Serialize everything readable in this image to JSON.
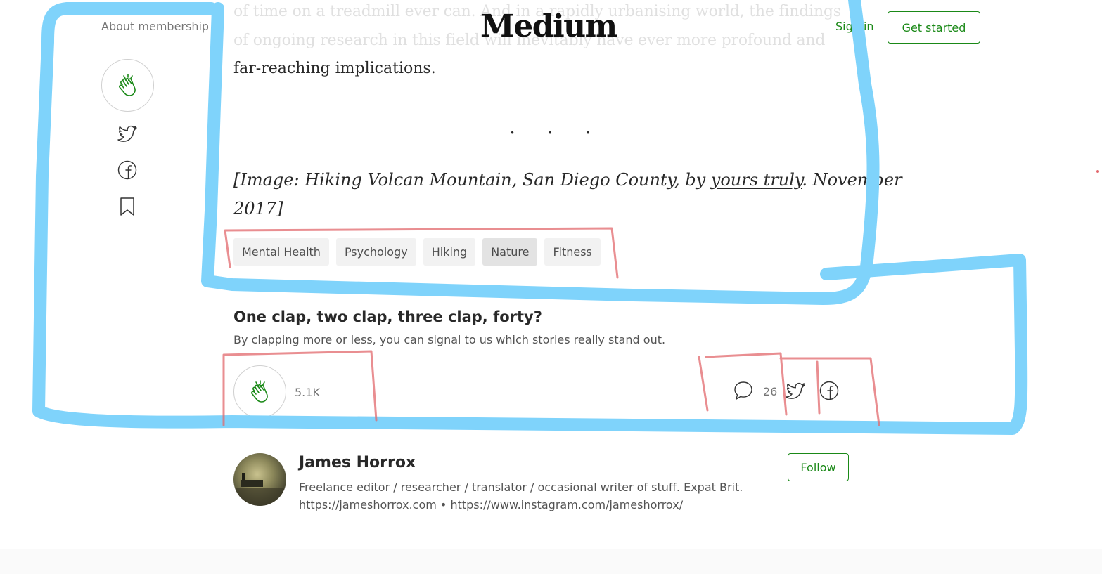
{
  "header": {
    "about_label": "About membership",
    "logo": "Medium",
    "signin_label": "Sign in",
    "get_started_label": "Get started"
  },
  "article": {
    "faded_lines": [
      "of time on a treadmill ever can. And in a rapidly urbanising world, the findings",
      "of ongoing research in this field will inevitably have ever more profound and"
    ],
    "last_line": "far-reaching implications.",
    "separator": ". . .",
    "caption_line1_pre": "[Image: Hiking Volcan Mountain, San Diego County, by ",
    "caption_link": "yours truly",
    "caption_line1_post": ". November",
    "caption_line2": "2017]"
  },
  "tags": [
    "Mental Health",
    "Psychology",
    "Hiking",
    "Nature",
    "Fitness"
  ],
  "clap_prompt": {
    "title": "One clap, two clap, three clap, forty?",
    "subtitle": "By clapping more or less, you can signal to us which stories really stand out."
  },
  "footer_actions": {
    "clap_count": "5.1K",
    "responses_count": "26"
  },
  "author": {
    "name": "James Horrox",
    "bio_line1": "Freelance editor / researcher / translator / occasional writer of stuff. Expat Brit.",
    "bio_line2": "https://jameshorrox.com • https://www.instagram.com/jameshorrox/",
    "follow_label": "Follow"
  },
  "colors": {
    "accent_green": "#1a8917",
    "annotation_blue": "#7fd3fb",
    "annotation_red": "#e2686c"
  },
  "icons": [
    "clap-icon",
    "twitter-icon",
    "facebook-icon",
    "bookmark-icon",
    "response-icon"
  ]
}
